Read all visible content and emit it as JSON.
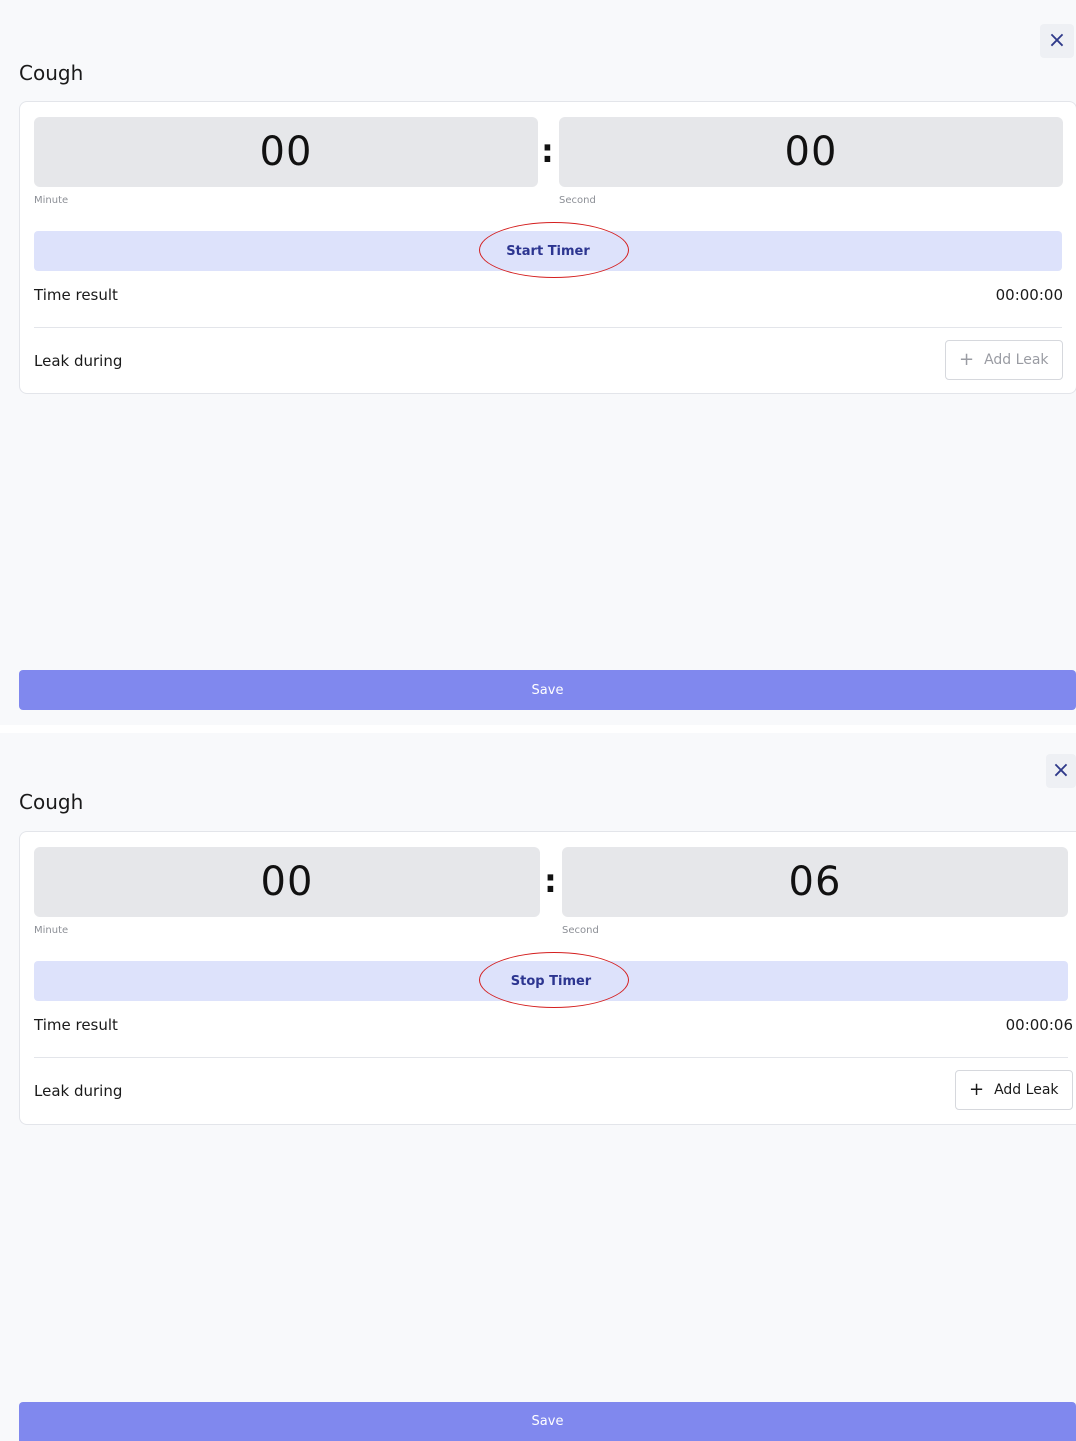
{
  "screens": [
    {
      "title": "Cough",
      "minutes": "00",
      "seconds": "00",
      "colon": ":",
      "minute_label": "Minute",
      "second_label": "Second",
      "timer_button_label": "Start Timer",
      "time_result_label": "Time result",
      "time_result_value": "00:00:00",
      "leak_label": "Leak during",
      "add_leak_plus": "+",
      "add_leak_label": "Add Leak",
      "save_label": "Save",
      "close_icon": "×"
    },
    {
      "title": "Cough",
      "minutes": "00",
      "seconds": "06",
      "colon": ":",
      "minute_label": "Minute",
      "second_label": "Second",
      "timer_button_label": "Stop Timer",
      "time_result_label": "Time result",
      "time_result_value": "00:00:06",
      "leak_label": "Leak during",
      "add_leak_plus": "+",
      "add_leak_label": "Add Leak",
      "save_label": "Save",
      "close_icon": "×"
    }
  ],
  "colors": {
    "save_button": "#8088ee",
    "timer_button_bg": "#dde2fb",
    "timer_button_text": "#2c3590",
    "annotation_circle": "#d41f1f",
    "time_box_bg": "#e6e7ea"
  }
}
